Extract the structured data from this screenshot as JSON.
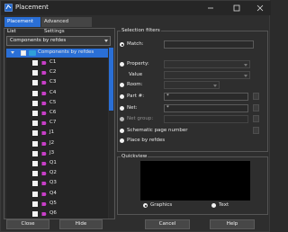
{
  "window": {
    "title": "Placement"
  },
  "tabs": [
    {
      "label": "Placement List"
    },
    {
      "label": "Advanced Settings"
    }
  ],
  "left": {
    "filter_combo": "Components by refdes",
    "tree": {
      "root_label": "Components by refdes",
      "items": [
        "C1",
        "C2",
        "C3",
        "C4",
        "C5",
        "C6",
        "C7",
        "J1",
        "J2",
        "J3",
        "Q1",
        "Q2",
        "Q3",
        "Q4",
        "Q5",
        "Q6"
      ]
    }
  },
  "selection_filters": {
    "title": "Selection filters",
    "match_label": "Match:",
    "property_label": "Property:",
    "value_label": "Value",
    "room_label": "Room:",
    "part_label": "Part #:",
    "part_value": "*",
    "net_label": "Net:",
    "net_value": "*",
    "net_group_label": "Net group:",
    "schematic_label": "Schematic page number",
    "place_label": "Place by refdes"
  },
  "quickview": {
    "title": "Quickview",
    "graphics_label": "Graphics",
    "text_label": "Text"
  },
  "buttons": {
    "close": "Close",
    "hide": "Hide",
    "cancel": "Cancel",
    "help": "Help"
  },
  "colors": {
    "accent": "#2a6fd6",
    "pin": "#c83fc8",
    "folder": "#2fa0d8"
  }
}
